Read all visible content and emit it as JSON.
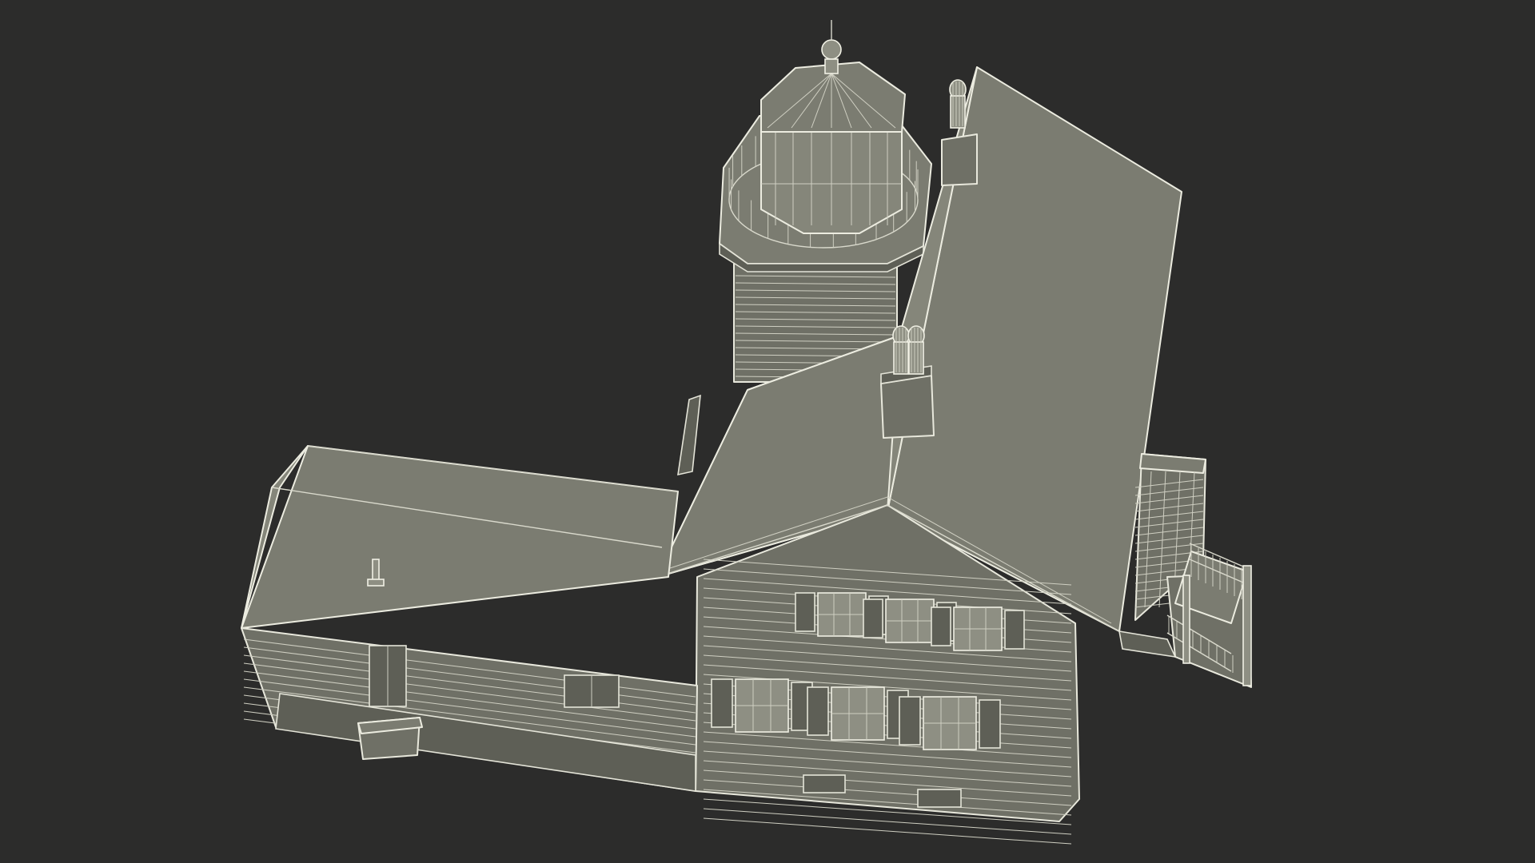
{
  "scene": {
    "subject": "lighthouse-keepers-house-wireframe",
    "background_color": "#2c2c2b",
    "model_fill_color": "#77786d",
    "wire_color": "#ecece0"
  }
}
